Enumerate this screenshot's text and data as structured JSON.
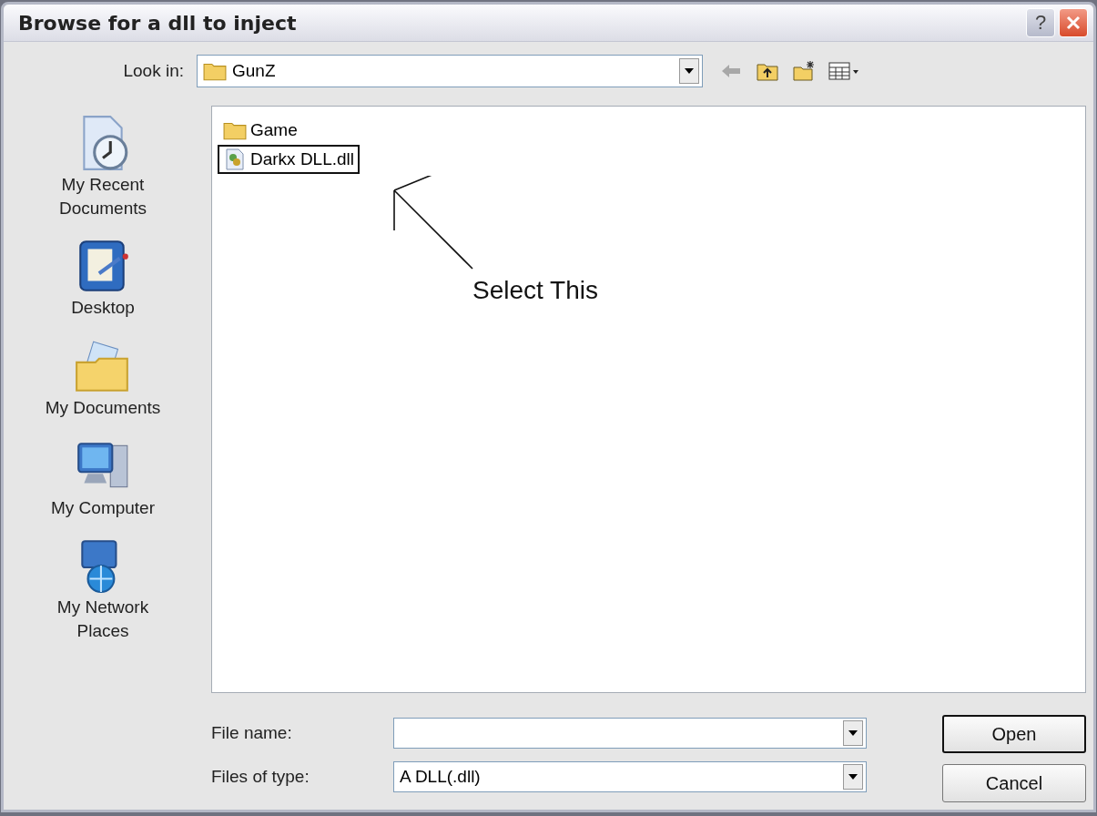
{
  "window": {
    "title": "Browse for a dll to inject",
    "help_button": "?"
  },
  "look_in": {
    "label": "Look in:",
    "value": "GunZ"
  },
  "places": [
    {
      "label": "My Recent Documents",
      "kind": "recent"
    },
    {
      "label": "Desktop",
      "kind": "desktop"
    },
    {
      "label": "My Documents",
      "kind": "documents"
    },
    {
      "label": "My Computer",
      "kind": "computer"
    },
    {
      "label": "My Network Places",
      "kind": "network"
    }
  ],
  "files": [
    {
      "name": "Game",
      "kind": "folder",
      "outlined": false
    },
    {
      "name": "Darkx DLL.dll",
      "kind": "dll",
      "outlined": true
    }
  ],
  "annotation": {
    "text": "Select This"
  },
  "file_name": {
    "label": "File name:"
  },
  "file_type": {
    "label": "Files of type:",
    "value": "A DLL(.dll)"
  },
  "buttons": [
    {
      "label": "Open",
      "default": true
    },
    {
      "label": "Cancel",
      "default": false
    }
  ]
}
